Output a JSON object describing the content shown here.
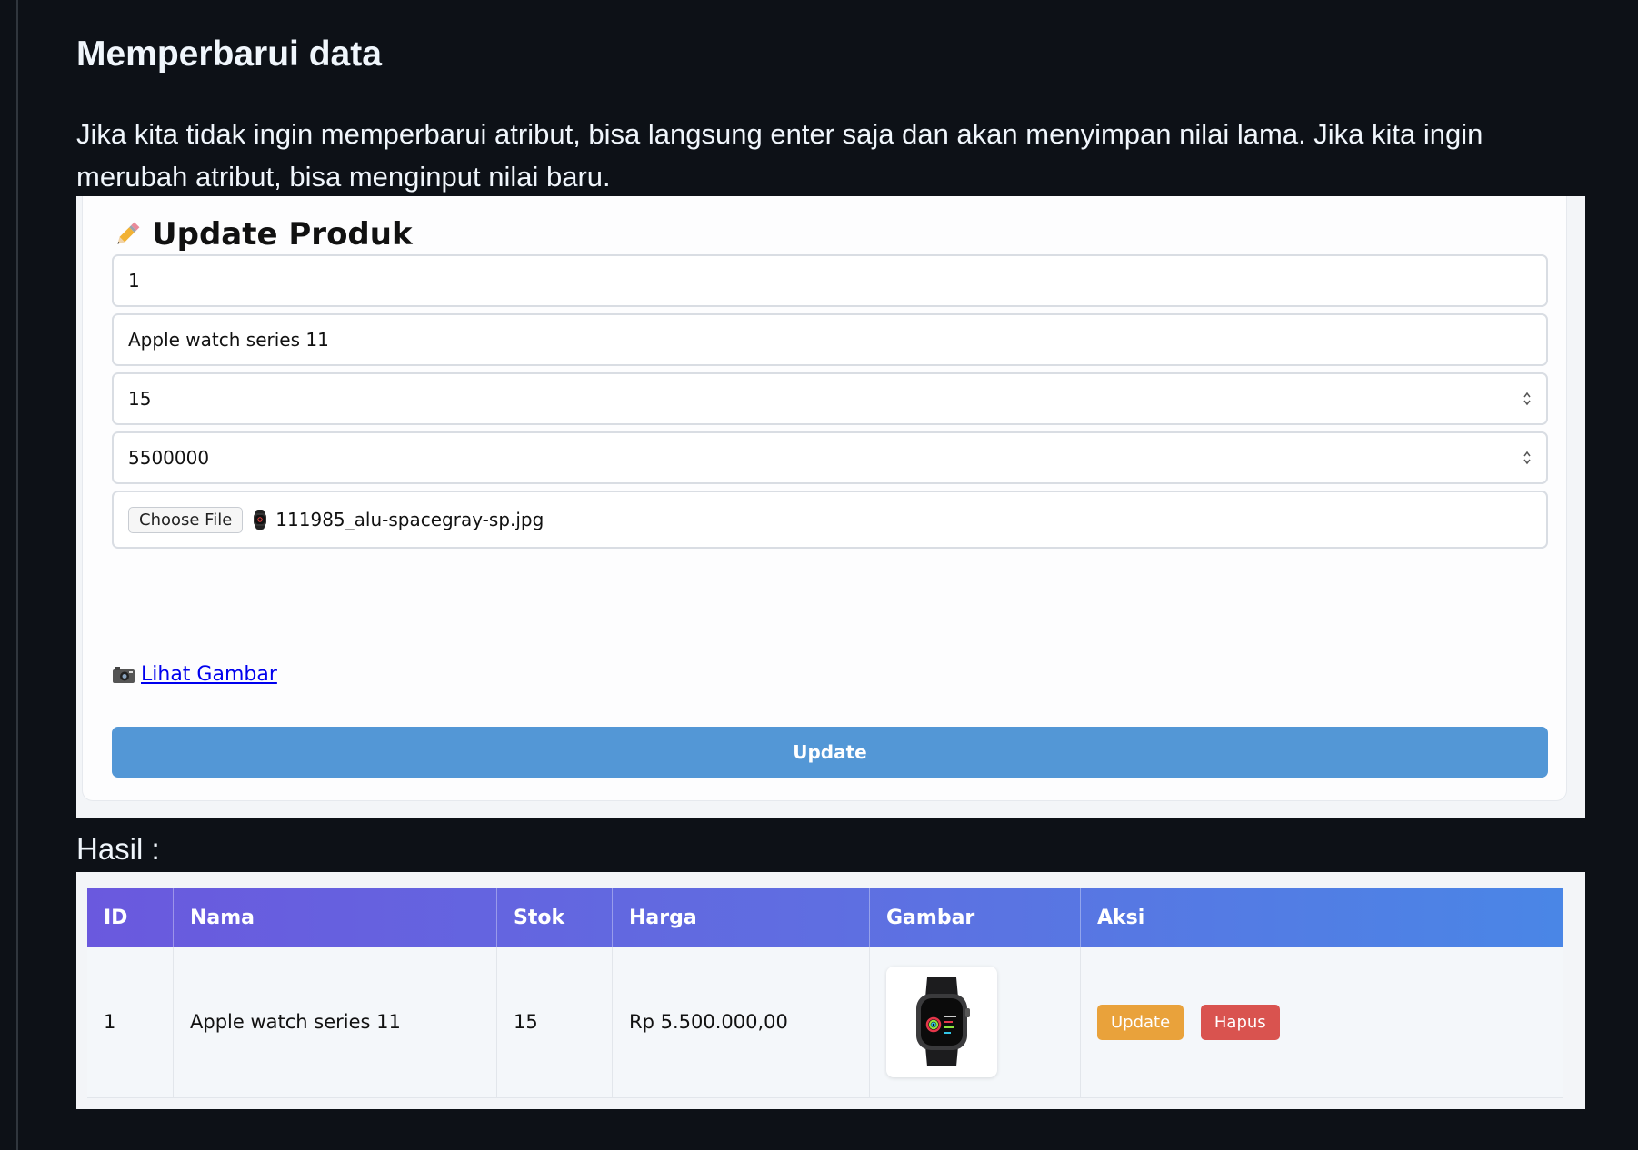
{
  "section": {
    "title": "Memperbarui data",
    "description": "Jika kita tidak ingin memperbarui atribut, bisa langsung enter saja dan akan menyimpan nilai lama. Jika kita ingin merubah atribut, bisa menginput nilai baru."
  },
  "form": {
    "icon": "pencil-icon",
    "title": "Update Produk",
    "id_value": "1",
    "name_value": "Apple watch series 11",
    "stock_value": "15",
    "price_value": "5500000",
    "choose_file_label": "Choose File",
    "file_name": "111985_alu-spacegray-sp.jpg",
    "view_image_icon": "camera-icon",
    "view_image_label": "Lihat Gambar",
    "submit_label": "Update",
    "accent_color": "#5397d6"
  },
  "result_label": "Hasil :",
  "table": {
    "headers": [
      "ID",
      "Nama",
      "Stok",
      "Harga",
      "Gambar",
      "Aksi"
    ],
    "rows": [
      {
        "id": "1",
        "name": "Apple watch series 11",
        "stock": "15",
        "price": "Rp 5.500.000,00",
        "image": "apple-watch-thumbnail",
        "update_label": "Update",
        "delete_label": "Hapus"
      }
    ],
    "header_gradient": [
      "#6a59de",
      "#4a86e6"
    ],
    "update_color": "#e9a23b",
    "delete_color": "#d9534f"
  }
}
